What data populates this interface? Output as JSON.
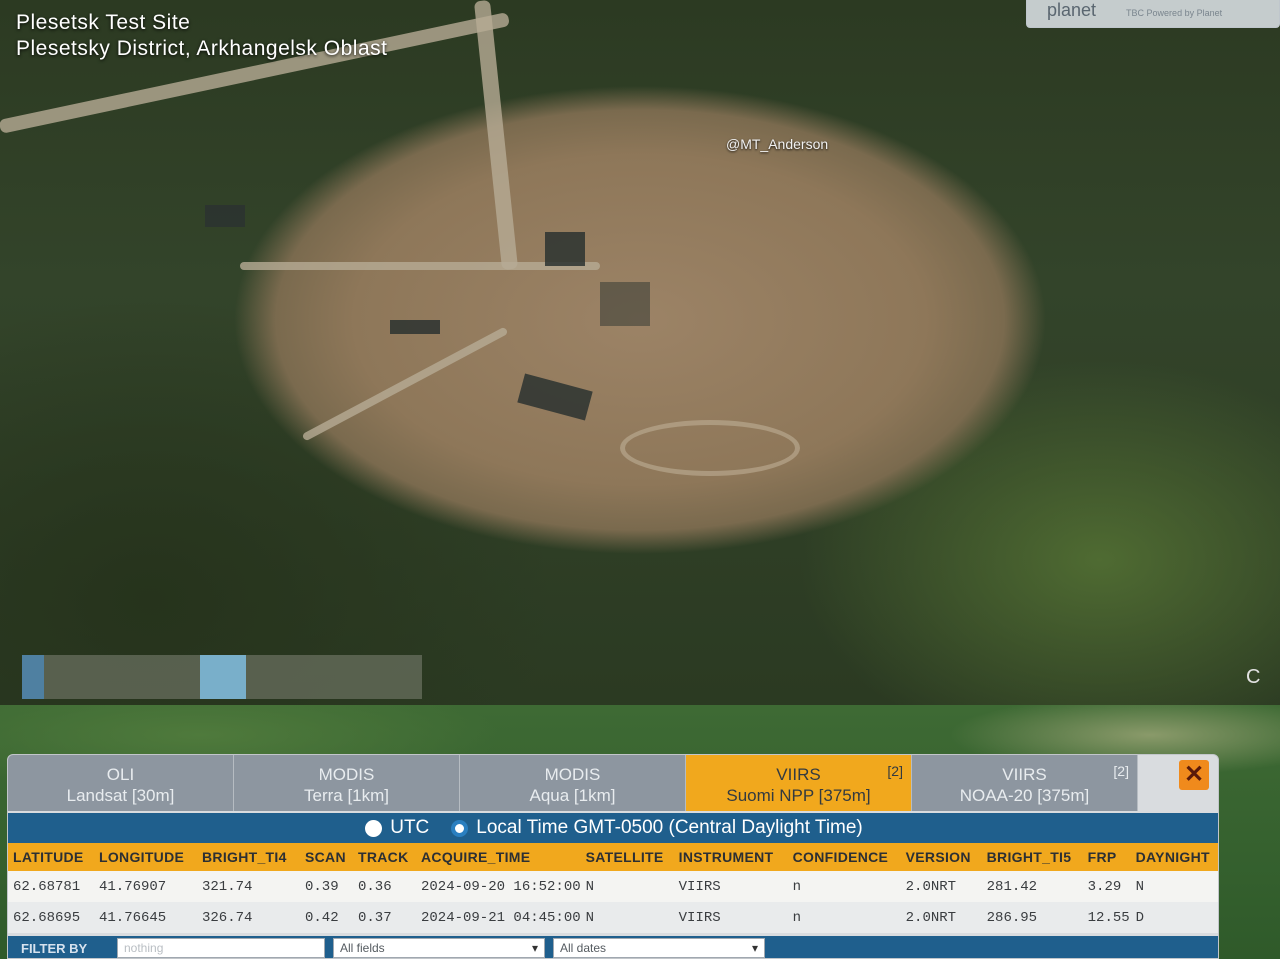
{
  "location": {
    "title": "Plesetsk Test Site",
    "subtitle": "Plesetsky District, Arkhangelsk Oblast"
  },
  "credit": "@MT_Anderson",
  "brand": {
    "name": "planet",
    "sub": "TBC Powered by Planet"
  },
  "corner_text": "C",
  "tabs": [
    {
      "line1": "OLI",
      "line2": "Landsat [30m]",
      "badge": "",
      "active": false
    },
    {
      "line1": "MODIS",
      "line2": "Terra [1km]",
      "badge": "",
      "active": false
    },
    {
      "line1": "MODIS",
      "line2": "Aqua [1km]",
      "badge": "",
      "active": false
    },
    {
      "line1": "VIIRS",
      "line2": "Suomi NPP [375m]",
      "badge": "[2]",
      "active": true
    },
    {
      "line1": "VIIRS",
      "line2": "NOAA-20 [375m]",
      "badge": "[2]",
      "active": false
    }
  ],
  "close_label": "✕",
  "timezone": {
    "utc_label": "UTC",
    "local_label": "Local Time GMT-0500 (Central Daylight Time)",
    "selected": "local"
  },
  "table": {
    "columns": [
      "LATITUDE",
      "LONGITUDE",
      "BRIGHT_TI4",
      "SCAN",
      "TRACK",
      "ACQUIRE_TIME",
      "SATELLITE",
      "INSTRUMENT",
      "CONFIDENCE",
      "VERSION",
      "BRIGHT_TI5",
      "FRP",
      "DAYNIGHT"
    ],
    "rows": [
      [
        "62.68781",
        "41.76907",
        "321.74",
        "0.39",
        "0.36",
        "2024-09-20 16:52:00",
        "N",
        "VIIRS",
        "n",
        "2.0NRT",
        "281.42",
        "3.29",
        "N"
      ],
      [
        "62.68695",
        "41.76645",
        "326.74",
        "0.42",
        "0.37",
        "2024-09-21 04:45:00",
        "N",
        "VIIRS",
        "n",
        "2.0NRT",
        "286.95",
        "12.55",
        "D"
      ]
    ]
  },
  "filter": {
    "label": "FILTER BY",
    "input_value": "nothing",
    "fields_select": "All fields",
    "dates_select": "All dates"
  }
}
